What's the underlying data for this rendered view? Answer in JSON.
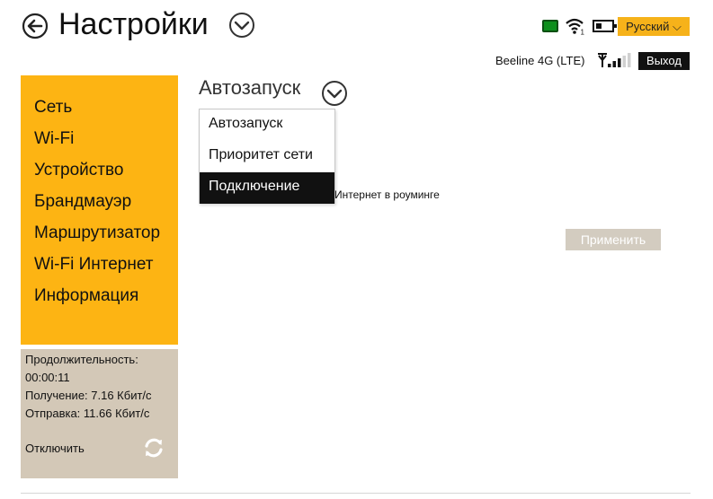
{
  "header": {
    "title": "Настройки",
    "language": "Русский ⌵",
    "network_name": "Beeline 4G (LTE)",
    "logout_label": "Выход",
    "wifi_clients": "1",
    "signal_bars": 3,
    "signal_bars_max": 5
  },
  "sidebar": {
    "items": [
      {
        "label": "Сеть",
        "active": true
      },
      {
        "label": "Wi-Fi",
        "active": false
      },
      {
        "label": "Устройство",
        "active": false
      },
      {
        "label": "Брандмауэр",
        "active": false
      },
      {
        "label": "Маршрутизатор",
        "active": false
      },
      {
        "label": "Wi-Fi  Интернет",
        "active": false
      },
      {
        "label": "Информация",
        "active": false
      }
    ]
  },
  "stats": {
    "duration_label": "Продолжительность:",
    "duration_value": "00:00:11",
    "received": "Получение: 7.16 Кбит/с",
    "sent": "Отправка: 11.66 Кбит/с",
    "disconnect_label": "Отключить"
  },
  "main": {
    "section_title": "Автозапуск",
    "hidden_label": "Интернет в роуминге",
    "apply_label": "Применить",
    "dropdown": {
      "items": [
        {
          "label": "Автозапуск",
          "selected": false
        },
        {
          "label": "Приоритет сети",
          "selected": false
        },
        {
          "label": "Подключение",
          "selected": true
        }
      ]
    }
  },
  "colors": {
    "accent": "#fdb413",
    "stats_bg": "#d3c8b7",
    "sim": "#0c8f1b"
  }
}
